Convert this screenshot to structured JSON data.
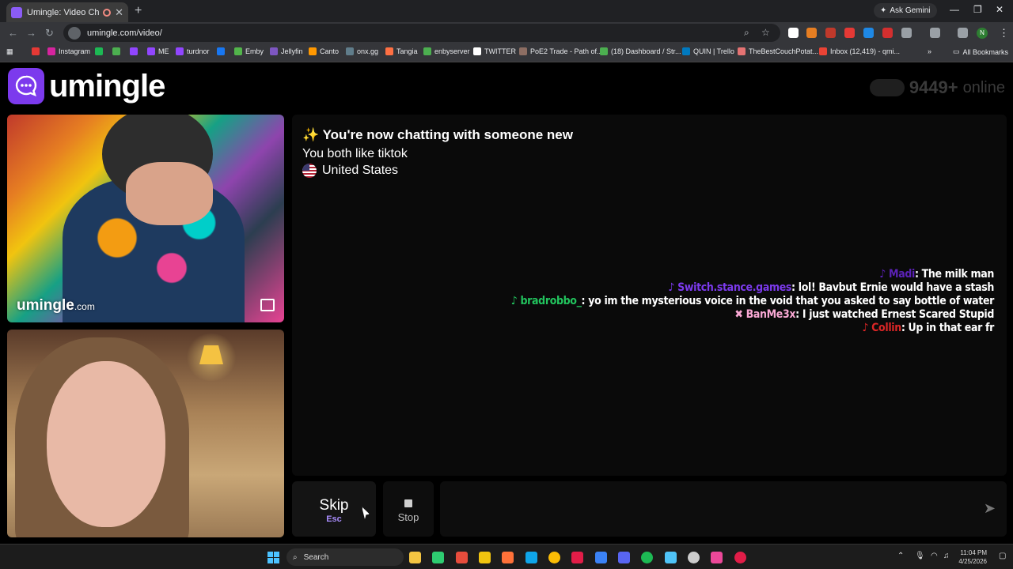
{
  "browser": {
    "tab_title": "Umingle: Video Chat with S",
    "ask_gemini": "Ask Gemini",
    "url": "umingle.com/video/",
    "bookmarks": [
      "Instagram",
      "ME",
      "turdnor",
      "Emby",
      "Jellyfin",
      "Canto",
      "onx.gg",
      "Tangia",
      "enbyserver",
      "TWITTER",
      "PoE2 Trade - Path of...",
      "(18) Dashboard / Str...",
      "QUIN | Trello",
      "TheBestCouchPotat...",
      "Inbox (12,419) - qmi..."
    ],
    "all_bookmarks": "All Bookmarks",
    "profile_initial": "N"
  },
  "header": {
    "logo_text": "umingle",
    "online_count": "9449+",
    "online_word": "online"
  },
  "video": {
    "watermark_main": "umingle",
    "watermark_suffix": ".com"
  },
  "chat": {
    "intro_title": "You're now chatting with someone new",
    "intro_sparkle": "✨",
    "common_interest": "You both like tiktok",
    "country": "United States",
    "messages": [
      {
        "icon": "♪",
        "user": "Madi",
        "user_color": "#5b21b6",
        "text": ": The milk man"
      },
      {
        "icon": "♪",
        "user": "Switch.stance.games",
        "user_color": "#7c3aed",
        "text": ": lol! Bavbut Ernie would have a stash"
      },
      {
        "icon": "♪",
        "user": "bradrobbo_",
        "user_color": "#22c55e",
        "text": ": yo im the mysterious voice in the void that you asked to say bottle of water"
      },
      {
        "icon": "✖",
        "user": "BanMe3x",
        "user_color": "#f9a8d4",
        "text": ": I just watched Ernest Scared Stupid"
      },
      {
        "icon": "♪",
        "user": "Collin",
        "user_color": "#dc2626",
        "text": ": Up in that ear fr"
      }
    ]
  },
  "controls": {
    "skip_label": "Skip",
    "skip_key": "Esc",
    "stop_label": "Stop",
    "send_icon": "➤"
  },
  "taskbar": {
    "search": "Search",
    "time": "11:04 PM",
    "date": "4/25/2026"
  }
}
